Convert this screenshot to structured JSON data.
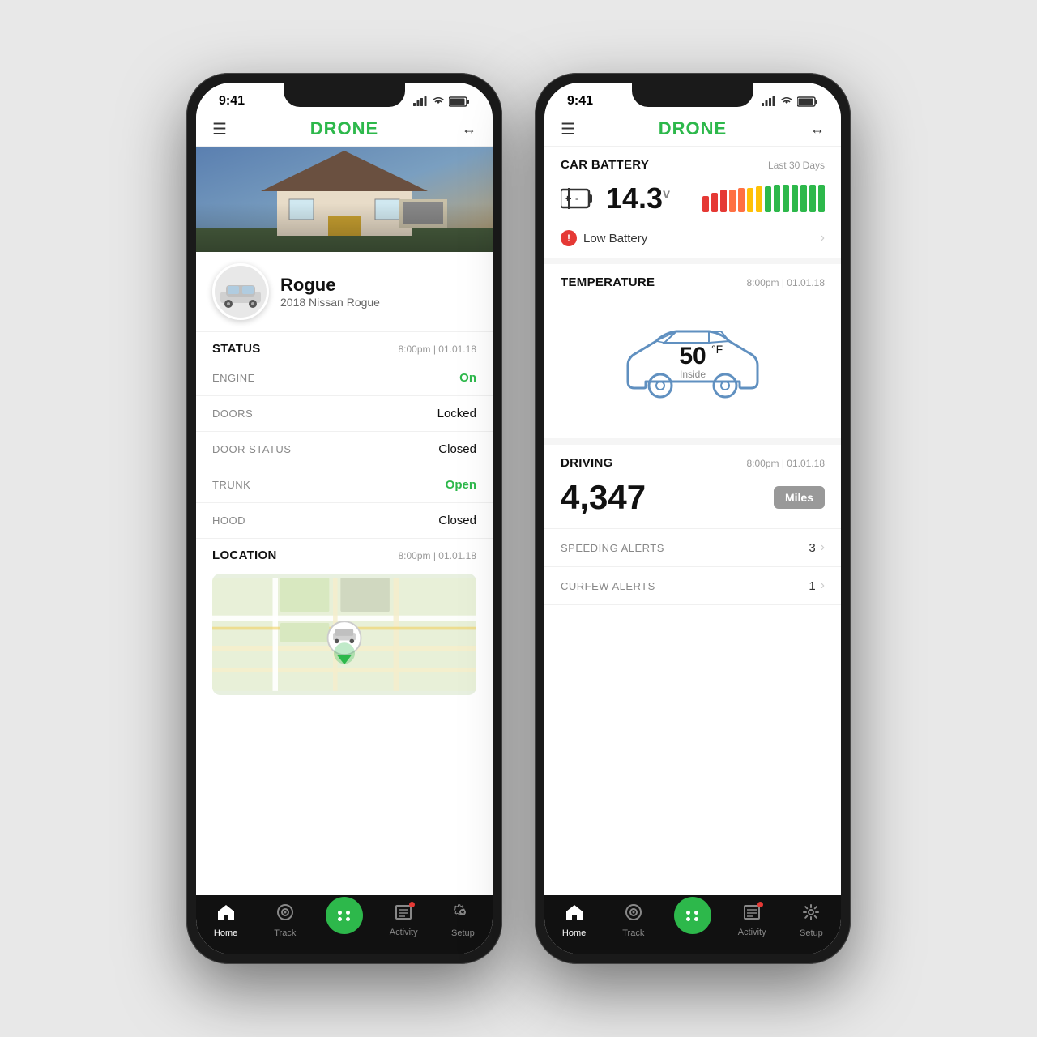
{
  "phone1": {
    "status_bar": {
      "time": "9:41"
    },
    "header": {
      "logo": "DRONE",
      "hamburger": "☰",
      "arrow": "↔"
    },
    "vehicle": {
      "name": "Rogue",
      "model": "2018 Nissan Rogue"
    },
    "status_section": {
      "title": "STATUS",
      "time": "8:00pm  |  01.01.18",
      "rows": [
        {
          "label": "ENGINE",
          "value": "On",
          "green": true
        },
        {
          "label": "DOORS",
          "value": "Locked",
          "green": false
        },
        {
          "label": "DOOR STATUS",
          "value": "Closed",
          "green": false
        },
        {
          "label": "TRUNK",
          "value": "Open",
          "green": true
        },
        {
          "label": "HOOD",
          "value": "Closed",
          "green": false
        }
      ]
    },
    "location_section": {
      "title": "LOCATION",
      "time": "8:00pm  |  01.01.18"
    },
    "nav": [
      {
        "label": "Home",
        "active": true
      },
      {
        "label": "Track",
        "active": false
      },
      {
        "label": "",
        "center": true
      },
      {
        "label": "Activity",
        "active": false,
        "dot": true
      },
      {
        "label": "Setup",
        "active": false
      }
    ]
  },
  "phone2": {
    "status_bar": {
      "time": "9:41"
    },
    "header": {
      "logo": "DRONE",
      "hamburger": "☰",
      "arrow": "↔"
    },
    "battery_section": {
      "title": "CAR BATTERY",
      "period": "Last 30 Days",
      "voltage": "14.3",
      "voltage_unit": "v",
      "alert_label": "Low Battery"
    },
    "temperature_section": {
      "title": "TEMPERATURE",
      "time": "8:00pm  |  01.01.18",
      "value": "50",
      "unit": "°F",
      "label": "Inside"
    },
    "driving_section": {
      "title": "DRIVING",
      "time": "8:00pm  |  01.01.18",
      "miles": "4,347",
      "miles_label": "Miles"
    },
    "alerts": [
      {
        "label": "SPEEDING ALERTS",
        "value": "3"
      },
      {
        "label": "CURFEW ALERTS",
        "value": "1"
      }
    ],
    "nav": [
      {
        "label": "Home",
        "active": true
      },
      {
        "label": "Track",
        "active": false
      },
      {
        "label": "",
        "center": true
      },
      {
        "label": "Activity",
        "active": false,
        "dot": true
      },
      {
        "label": "Setup",
        "active": false
      }
    ]
  }
}
